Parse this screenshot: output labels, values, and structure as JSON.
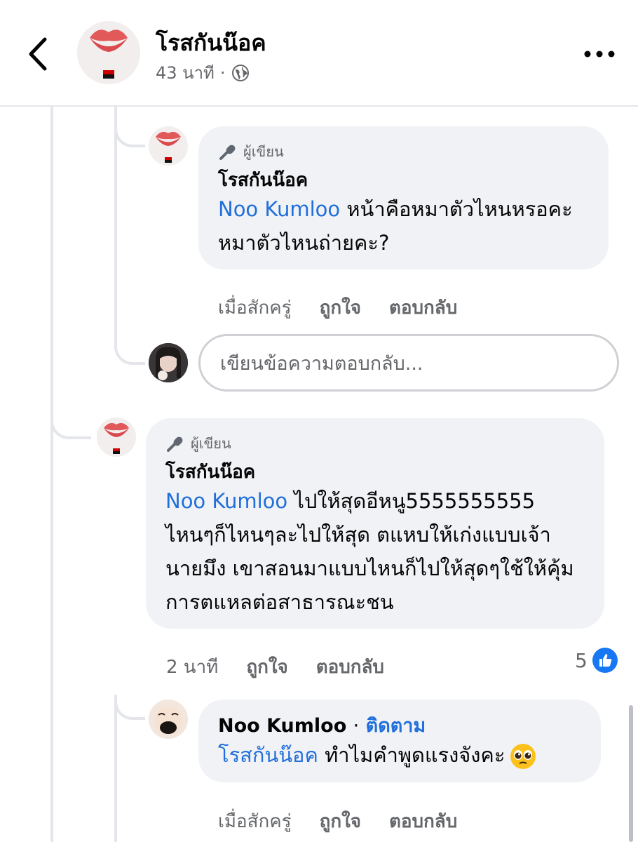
{
  "header": {
    "back_icon": "chevron-left-icon",
    "name": "โรสกันน๊อค",
    "time": "43 นาที",
    "separator": "·",
    "privacy_icon": "globe-icon",
    "more_icon": "more-horizontal-icon"
  },
  "comments": [
    {
      "author_badge": "ผู้เขียน",
      "name": "โรสกันน๊อค",
      "mention": "Noo Kumloo",
      "text": " หน้าคือหมาตัวไหนหรอคะ หมาตัวไหนถ่ายคะ?",
      "actions": {
        "time": "เมื่อสักครู่",
        "like": "ถูกใจ",
        "reply": "ตอบกลับ"
      }
    },
    {
      "author_badge": "ผู้เขียน",
      "name": "โรสกันน๊อค",
      "mention": "Noo Kumloo",
      "text": " ไปให้สุดอีหนู5555555555 ไหนๆก็ไหนๆละไปให้สุด ตแหบให้เก่งแบบเจ้านายมึง เขาสอนมาแบบไหนก็ไปให้สุดๆใช้ให้คุ้มการตแหลต่อสาธารณะชน",
      "actions": {
        "time": "2 นาที",
        "like": "ถูกใจ",
        "reply": "ตอบกลับ"
      },
      "like_count": "5"
    },
    {
      "name": "Noo Kumloo",
      "separator": "·",
      "follow": "ติดตาม",
      "mention": "โรสกันน๊อค",
      "text": " ทำไมคำพูดแรงจังคะ",
      "emoji": "pleading-face-icon",
      "actions": {
        "time": "เมื่อสักครู่",
        "like": "ถูกใจ",
        "reply": "ตอบกลับ"
      }
    }
  ],
  "reply_box": {
    "placeholder": "เขียนข้อความตอบกลับ..."
  },
  "colors": {
    "link": "#216fdb",
    "bubble": "#f0f2f5",
    "secondary_text": "#65676b",
    "like_blue": "#1877f2"
  }
}
